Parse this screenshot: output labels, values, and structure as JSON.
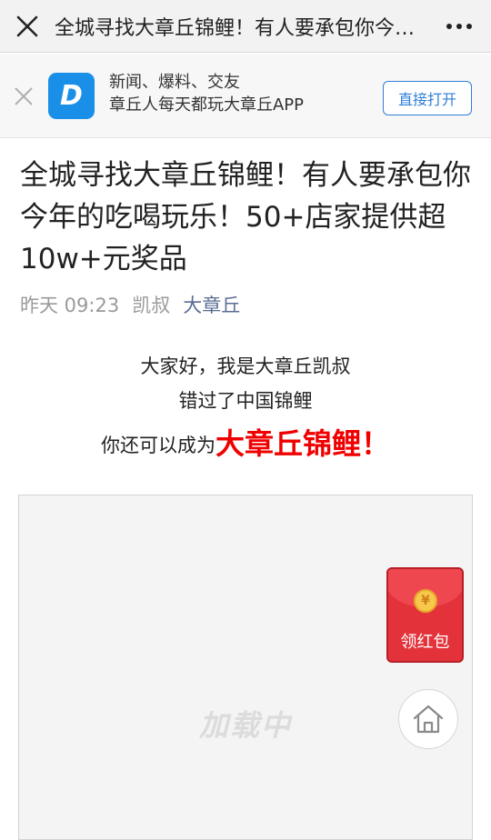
{
  "navbar": {
    "title": "全城寻找大章丘锦鲤！有人要承包你今年的吃喝玩乐！50+店家提供超10w+元奖品",
    "close_icon": "close-icon",
    "more_icon": "more-icon"
  },
  "banner": {
    "logo_letter": "D",
    "line1": "新闻、爆料、交友",
    "line2": "章丘人每天都玩大章丘APP",
    "open_label": "直接打开"
  },
  "article": {
    "title": "全城寻找大章丘锦鲤！有人要承包你今年的吃喝玩乐！50+店家提供超10w+元奖品",
    "meta": {
      "time": "昨天 09:23",
      "author": "凯叔",
      "account": "大章丘"
    },
    "lines": [
      "大家好，我是大章丘凯叔",
      "错过了中国锦鲤"
    ],
    "line3_prefix": "你还可以成为",
    "line3_highlight": "大章丘锦鲤！"
  },
  "media": {
    "loading_text": "加载中"
  },
  "red_packet": {
    "label": "领红包",
    "coin_symbol": "¥"
  },
  "colors": {
    "highlight": "#f00000",
    "link": "#586c94",
    "button_blue": "#2e7ed8"
  }
}
